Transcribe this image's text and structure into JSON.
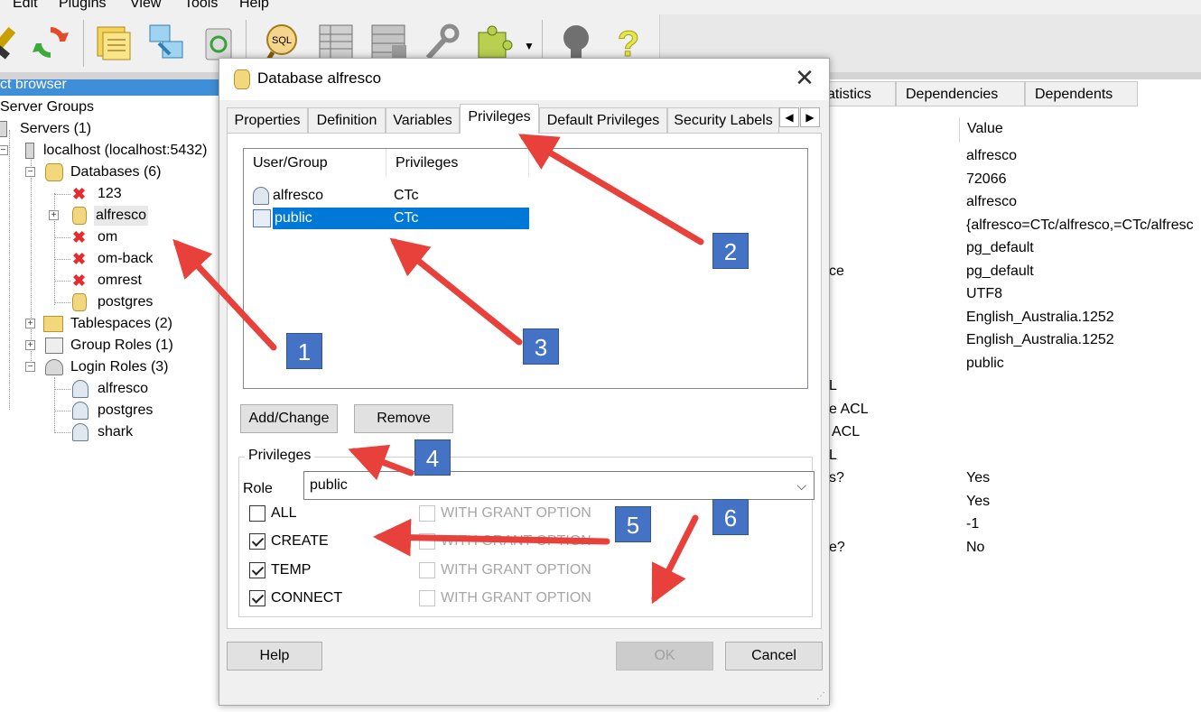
{
  "menubar": {
    "items": [
      "Edit",
      "Plugins",
      "View",
      "Tools",
      "Help"
    ]
  },
  "toolbar": {
    "icons": [
      "plug-icon",
      "refresh-icon",
      "properties-icon",
      "export-icon",
      "recycle-icon",
      "sql-icon",
      "table-icon",
      "grid-icon",
      "wrench-icon",
      "plugin-icon",
      "dropdown-icon",
      "hint-icon",
      "help-icon"
    ]
  },
  "object_browser": {
    "title": "ct browser",
    "tree": {
      "server_groups": "Server Groups",
      "servers": "Servers (1)",
      "localhost": "localhost (localhost:5432)",
      "databases": "Databases (6)",
      "db_items": [
        "123",
        "alfresco",
        "om",
        "om-back",
        "omrest",
        "postgres"
      ],
      "tablespaces": "Tablespaces (2)",
      "group_roles": "Group Roles (1)",
      "login_roles": "Login Roles (3)",
      "login_items": [
        "alfresco",
        "postgres",
        "shark"
      ]
    }
  },
  "properties_panel": {
    "tabs": [
      "atistics",
      "Dependencies",
      "Dependents"
    ],
    "value_header": "Value",
    "left_fragments": [
      "ce",
      "L",
      "e ACL",
      "ACL",
      "L",
      "s?",
      "e?"
    ],
    "values": [
      "alfresco",
      "72066",
      "alfresco",
      "{alfresco=CTc/alfresco,=CTc/alfresc",
      "pg_default",
      "pg_default",
      "UTF8",
      "English_Australia.1252",
      "English_Australia.1252",
      "public",
      "Yes",
      "Yes",
      "-1",
      "No"
    ]
  },
  "dialog": {
    "title": "Database alfresco",
    "tabs": [
      "Properties",
      "Definition",
      "Variables",
      "Privileges",
      "Default Privileges",
      "Security Labels"
    ],
    "active_tab": "Privileges",
    "list": {
      "columns": [
        "User/Group",
        "Privileges"
      ],
      "rows": [
        {
          "user": "alfresco",
          "privileges": "CTc"
        },
        {
          "user": "public",
          "privileges": "CTc"
        }
      ]
    },
    "add_change_label": "Add/Change",
    "remove_label": "Remove",
    "privileges_group_title": "Privileges",
    "role_label": "Role",
    "role_value": "public",
    "checks": [
      {
        "label": "ALL",
        "checked": false,
        "grant": "WITH GRANT OPTION"
      },
      {
        "label": "CREATE",
        "checked": true,
        "grant": "WITH GRANT OPTION"
      },
      {
        "label": "TEMP",
        "checked": true,
        "grant": "WITH GRANT OPTION"
      },
      {
        "label": "CONNECT",
        "checked": true,
        "grant": "WITH GRANT OPTION"
      }
    ],
    "help_label": "Help",
    "ok_label": "OK",
    "cancel_label": "Cancel"
  },
  "annotations": {
    "badges": [
      "1",
      "2",
      "3",
      "4",
      "5",
      "6"
    ],
    "color": "#4472c4",
    "arrow_color": "#e8403a"
  }
}
